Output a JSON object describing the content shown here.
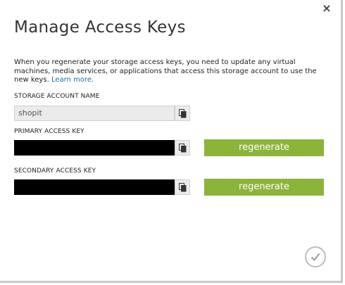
{
  "dialog": {
    "title": "Manage Access Keys",
    "close_glyph": "×",
    "description": "When you regenerate your storage access keys, you need to update any virtual machines, media services, or applications that access this storage account to use the new keys.",
    "learn_more": "Learn more."
  },
  "fields": {
    "account_name_label": "STORAGE ACCOUNT NAME",
    "account_name_value": "shopit",
    "primary_label": "PRIMARY ACCESS KEY",
    "secondary_label": "SECONDARY ACCESS KEY"
  },
  "buttons": {
    "regenerate_primary": "regenerate",
    "regenerate_secondary": "regenerate"
  },
  "icons": {
    "copy": "copy-icon",
    "close": "close-icon",
    "confirm": "checkmark-icon"
  },
  "colors": {
    "accent_green": "#8cb33a",
    "link_blue": "#1a6fb5"
  }
}
